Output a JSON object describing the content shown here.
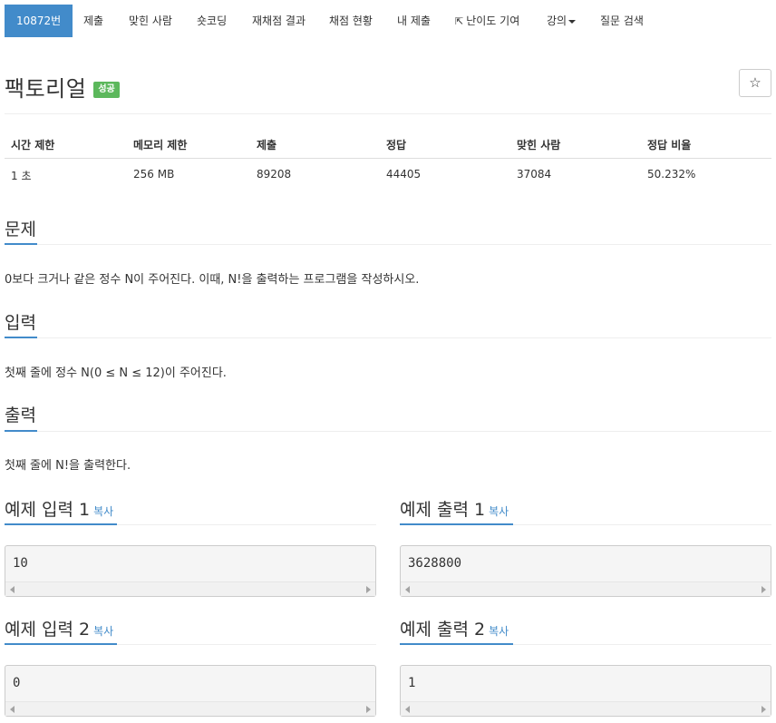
{
  "nav": {
    "items": [
      {
        "label": "10872번",
        "active": true
      },
      {
        "label": "제출"
      },
      {
        "label": "맞힌 사람"
      },
      {
        "label": "숏코딩"
      },
      {
        "label": "재채점 결과"
      },
      {
        "label": "채점 현황"
      },
      {
        "label": "내 제출"
      },
      {
        "label": "난이도 기여",
        "icon": "external-link-icon"
      },
      {
        "label": "강의",
        "icon": "caret-down-icon"
      },
      {
        "label": "질문 검색"
      }
    ]
  },
  "problem": {
    "title": "팩토리얼",
    "badge": "성공",
    "star_icon": "☆"
  },
  "info": {
    "headers": [
      "시간 제한",
      "메모리 제한",
      "제출",
      "정답",
      "맞힌 사람",
      "정답 비율"
    ],
    "values": [
      "1 초",
      "256 MB",
      "89208",
      "44405",
      "37084",
      "50.232%"
    ]
  },
  "sections": {
    "description": {
      "title": "문제",
      "text": "0보다 크거나 같은 정수 N이 주어진다. 이때, N!을 출력하는 프로그램을 작성하시오."
    },
    "input": {
      "title": "입력",
      "text": "첫째 줄에 정수 N(0 ≤ N ≤ 12)이 주어진다."
    },
    "output": {
      "title": "출력",
      "text": "첫째 줄에 N!을 출력한다."
    }
  },
  "examples": {
    "copy_label": "복사",
    "input1": {
      "title": "예제 입력 1",
      "value": "10"
    },
    "output1": {
      "title": "예제 출력 1",
      "value": "3628800"
    },
    "input2": {
      "title": "예제 입력 2",
      "value": "0"
    },
    "output2": {
      "title": "예제 출력 2",
      "value": "1"
    }
  },
  "colors": {
    "accent": "#428bca",
    "success": "#5cb85c"
  }
}
